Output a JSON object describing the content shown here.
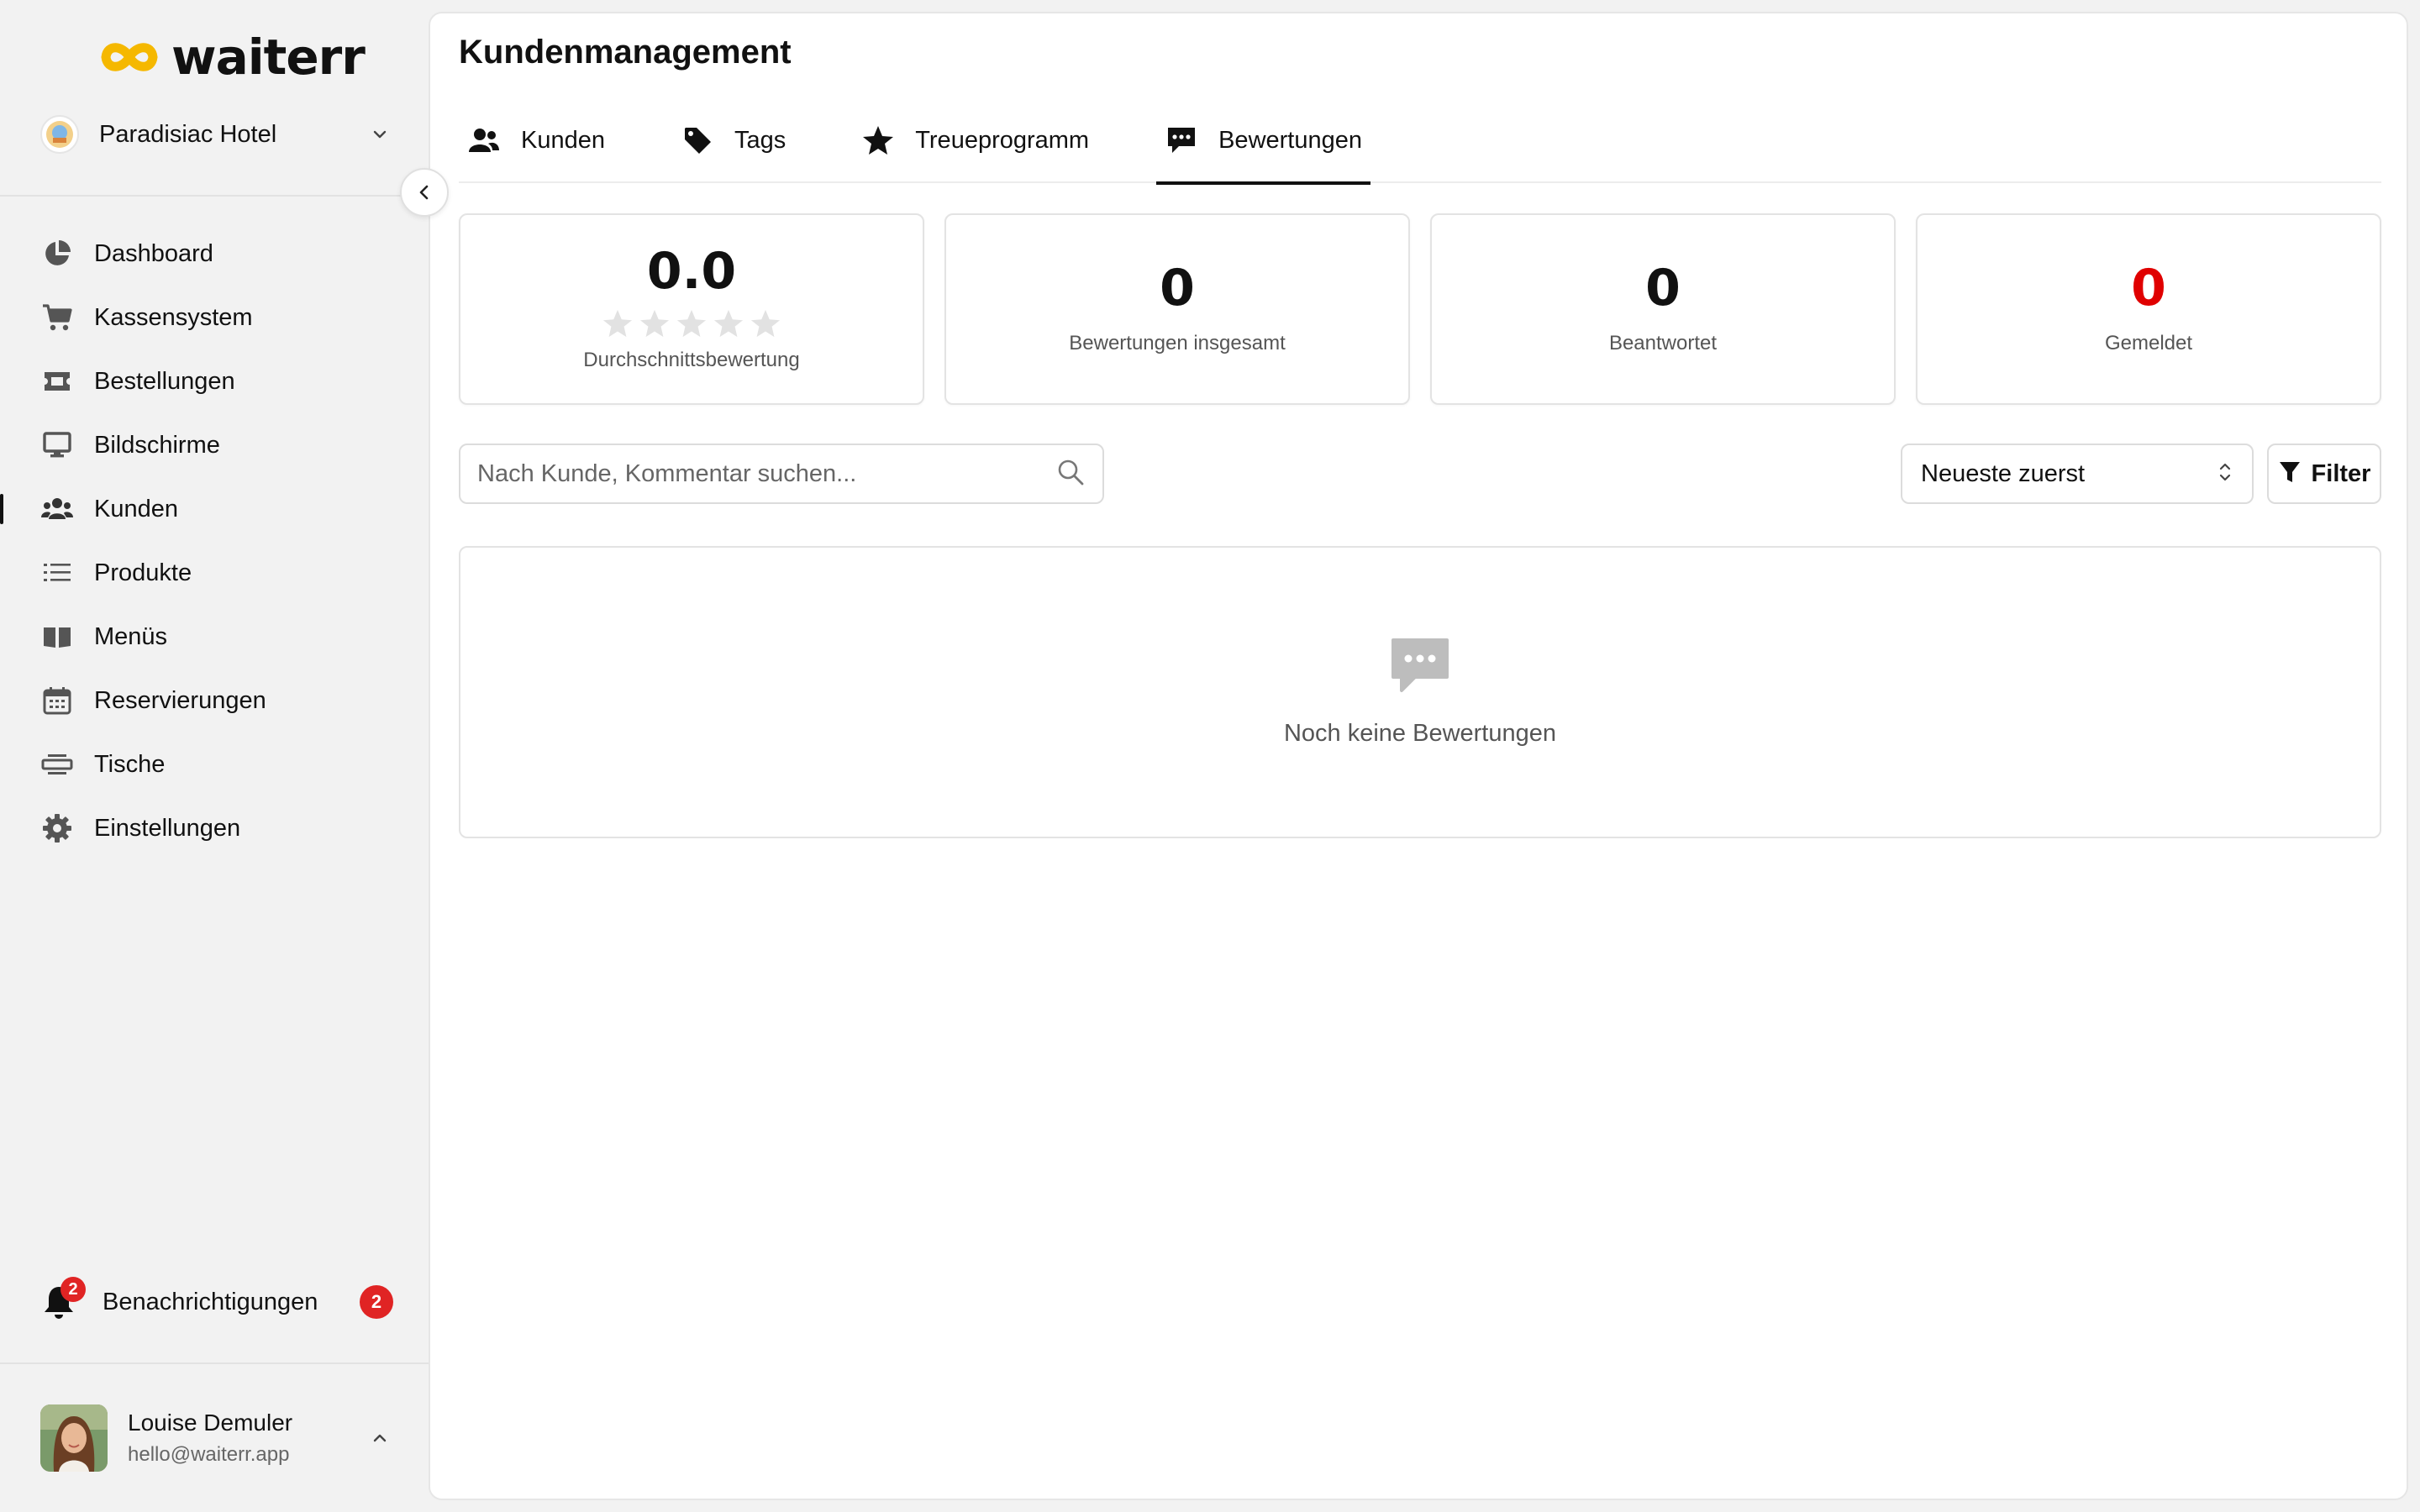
{
  "app": {
    "logo_text": "waiterr"
  },
  "venue": {
    "name": "Paradisiac Hotel"
  },
  "sidebar": {
    "items": [
      {
        "label": "Dashboard",
        "icon": "pie-chart-icon"
      },
      {
        "label": "Kassensystem",
        "icon": "cart-icon"
      },
      {
        "label": "Bestellungen",
        "icon": "ticket-icon"
      },
      {
        "label": "Bildschirme",
        "icon": "monitor-icon"
      },
      {
        "label": "Kunden",
        "icon": "users-icon",
        "active": true
      },
      {
        "label": "Produkte",
        "icon": "list-icon"
      },
      {
        "label": "Menüs",
        "icon": "book-icon"
      },
      {
        "label": "Reservierungen",
        "icon": "calendar-icon"
      },
      {
        "label": "Tische",
        "icon": "table-icon"
      },
      {
        "label": "Einstellungen",
        "icon": "gear-icon"
      }
    ],
    "notifications": {
      "label": "Benachrichtigungen",
      "count": "2"
    },
    "user": {
      "name": "Louise Demuler",
      "email": "hello@waiterr.app"
    }
  },
  "main": {
    "title": "Kundenmanagement",
    "tabs": [
      {
        "label": "Kunden",
        "icon": "users-icon"
      },
      {
        "label": "Tags",
        "icon": "tag-icon"
      },
      {
        "label": "Treueprogramm",
        "icon": "star-icon"
      },
      {
        "label": "Bewertungen",
        "icon": "comment-icon",
        "active": true
      }
    ],
    "stats": [
      {
        "value": "0.0",
        "label": "Durchschnittsbewertung",
        "rating": 0
      },
      {
        "value": "0",
        "label": "Bewertungen insgesamt"
      },
      {
        "value": "0",
        "label": "Beantwortet"
      },
      {
        "value": "0",
        "label": "Gemeldet",
        "color": "#e00000"
      }
    ],
    "search": {
      "placeholder": "Nach Kunde, Kommentar suchen...",
      "value": ""
    },
    "sort": {
      "selected": "Neueste zuerst"
    },
    "filter_label": "Filter",
    "empty_text": "Noch keine Bewertungen"
  },
  "colors": {
    "accent_logo": "#f5b800",
    "danger": "#e02424",
    "text": "#111111"
  }
}
